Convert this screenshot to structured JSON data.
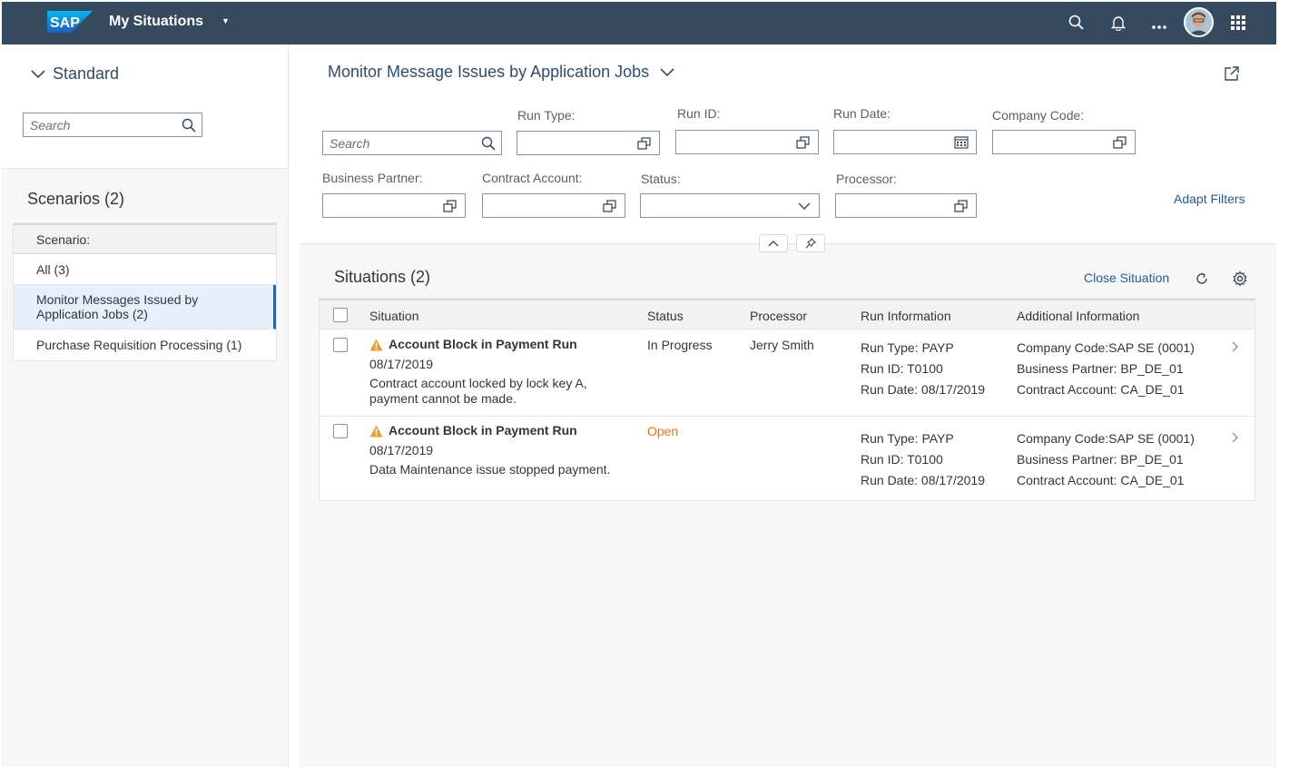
{
  "shell": {
    "logo": "SAP",
    "title": "My Situations",
    "colors": {
      "shell_bg": "#354a5f",
      "accent": "#0a6ed1",
      "warning": "#e9a12d",
      "open_status": "#e9730c"
    }
  },
  "left": {
    "variant": "Standard",
    "search_placeholder": "Search",
    "scenarios_title": "Scenarios (2)",
    "scenario_header": "Scenario:",
    "scenarios": [
      {
        "label": "All (3)"
      },
      {
        "label": "Monitor Messages Issued by Application Jobs (2)"
      },
      {
        "label": "Purchase Requisition Processing (1)"
      }
    ]
  },
  "main": {
    "title": "Monitor Message Issues by Application Jobs",
    "search_placeholder": "Search",
    "filters": {
      "run_type": "Run Type:",
      "run_id": "Run ID:",
      "run_date": "Run Date:",
      "company_code": "Company Code:",
      "business_partner": "Business Partner:",
      "contract_account": "Contract Account:",
      "status": "Status:",
      "processor": "Processor:"
    },
    "adapt_filters": "Adapt Filters"
  },
  "situations": {
    "title": "Situations (2)",
    "close_label": "Close Situation",
    "columns": {
      "situation": "Situation",
      "status": "Status",
      "processor": "Processor",
      "run_info": "Run Information",
      "additional": "Additional Information"
    },
    "rows": [
      {
        "name": "Account Block in Payment Run",
        "date": "08/17/2019",
        "description": "Contract account locked by lock key A, payment cannot be made.",
        "status": "In Progress",
        "processor": "Jerry Smith",
        "run_type": "Run Type: PAYP",
        "run_id": "Run ID: T0100",
        "run_date": "Run Date: 08/17/2019",
        "company_code": "Company Code:SAP SE (0001)",
        "business_partner": "Business Partner: BP_DE_01",
        "contract_account": "Contract Account: CA_DE_01"
      },
      {
        "name": "Account Block in Payment Run",
        "date": "08/17/2019",
        "description": "Data Maintenance issue stopped payment.",
        "status": "Open",
        "processor": "",
        "run_type": "Run Type: PAYP",
        "run_id": "Run ID: T0100",
        "run_date": "Run Date: 08/17/2019",
        "company_code": "Company Code:SAP SE (0001)",
        "business_partner": "Business Partner: BP_DE_01",
        "contract_account": "Contract Account: CA_DE_01"
      }
    ]
  }
}
